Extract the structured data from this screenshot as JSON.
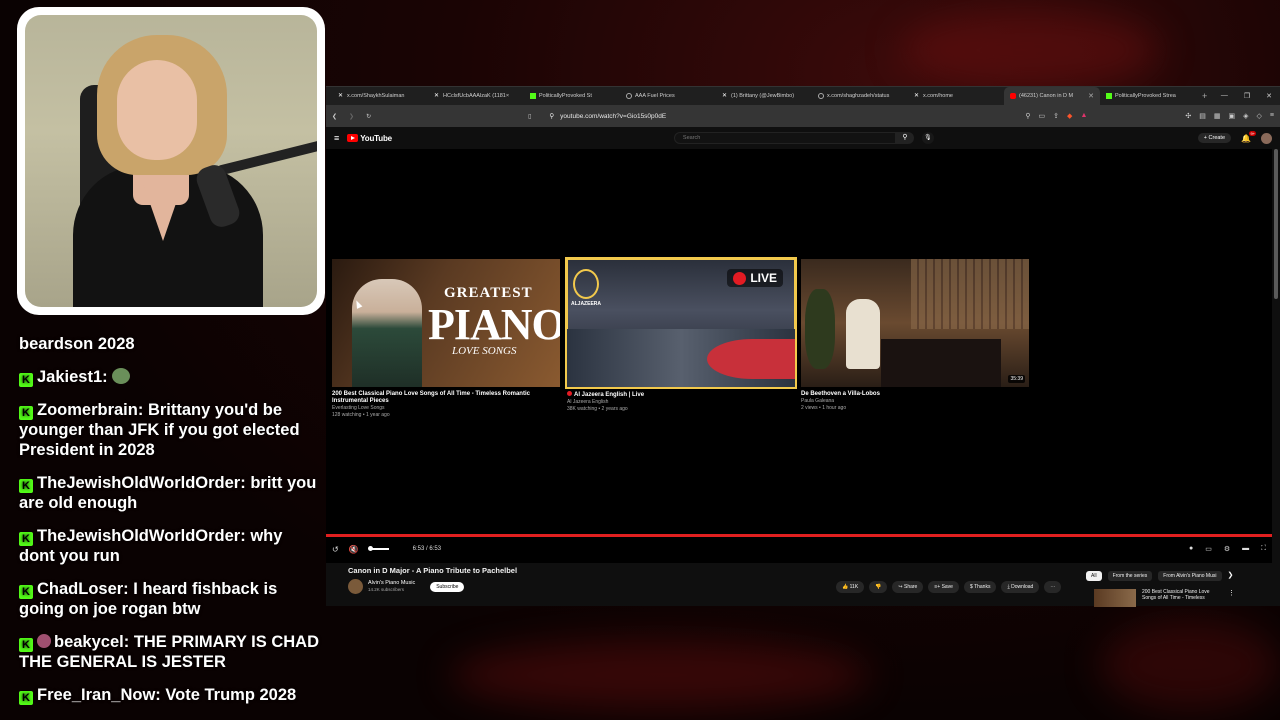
{
  "chat": {
    "messages": [
      {
        "user": "beardson 2028",
        "text": "",
        "badge": false
      },
      {
        "user": "Jakiest1:",
        "text": "",
        "badge": true,
        "emote": "pepe-emote"
      },
      {
        "user": "Zoomerbrain:",
        "text": "Brittany you'd be younger than JFK if you got elected President in 2028",
        "badge": true
      },
      {
        "user": "TheJewishOldWorldOrder:",
        "text": "britt you are old enough",
        "badge": true
      },
      {
        "user": "TheJewishOldWorldOrder:",
        "text": "why dont you run",
        "badge": true
      },
      {
        "user": "ChadLoser:",
        "text": "I heard fishback is going on joe rogan btw",
        "badge": true
      },
      {
        "user": "beakycel:",
        "text": "THE PRIMARY IS CHAD THE GENERAL IS JESTER",
        "badge": true,
        "avatar": true
      },
      {
        "user": "Free_Iran_Now:",
        "text": "Vote Trump 2028",
        "badge": true
      }
    ]
  },
  "browser": {
    "tabs": [
      {
        "label": "x.com/ShaykhSulaiman",
        "icon": "x-icon"
      },
      {
        "label": "HCclsfUcbAAAlzaK (1181×",
        "icon": "x-icon"
      },
      {
        "label": "PoliticallyProvoked St",
        "icon": "kick-icon"
      },
      {
        "label": "AAA Fuel Prices",
        "icon": "globe-icon"
      },
      {
        "label": "(1) Brittany (@JewBimbo)",
        "icon": "x-icon"
      },
      {
        "label": "x.com/shaghzadeh/status",
        "icon": "globe-icon"
      },
      {
        "label": "x.com/home",
        "icon": "x-icon"
      },
      {
        "label": "(46231) Canon in D M",
        "icon": "youtube-icon",
        "active": true
      },
      {
        "label": "PoliticallyProvoked Strea",
        "icon": "kick-icon"
      }
    ],
    "new_tab": "+",
    "url": "youtube.com/watch?v=Gio15s0p0dE"
  },
  "youtube": {
    "logo": "YouTube",
    "search_placeholder": "Search",
    "create_label": "Create",
    "notif_count": "9+",
    "endcards": [
      {
        "title": "200 Best Classical Piano Love Songs of All Time - Timeless Romantic Instrumental Pieces",
        "channel": "Everlasting Love Songs",
        "meta": "128 watching • 1 year ago",
        "thumb_word1": "GREATEST",
        "thumb_word2": "PIANO",
        "thumb_word3": "LOVE SONGS"
      },
      {
        "title": "Al Jazeera English | Live",
        "channel": "Al Jazeera English",
        "meta": "38K watching • 2 years ago",
        "live_label": "LIVE",
        "network": "ALJAZEERA",
        "live": true
      },
      {
        "title": "De Beethoven a Villa-Lobos",
        "channel": "Paula Galeana",
        "meta": "2 views • 1 hour ago",
        "duration": "35:39"
      }
    ],
    "time": "6:53 / 6:53",
    "progress": 1.0,
    "video_title": "Canon in D Major - A Piano Tribute to Pachelbel",
    "channel_name": "Alvin's Piano Music",
    "channel_subs": "14.2K subscribers",
    "subscribe_label": "Subscribe",
    "actions": {
      "like": "11K",
      "share": "Share",
      "save": "Save",
      "thanks": "Thanks",
      "download": "Download"
    },
    "chips": [
      "All",
      "From the series",
      "From Alvin's Piano Musi"
    ],
    "rec_title": "200 Best Classical Piano Love Songs of All Time - Timeless"
  }
}
